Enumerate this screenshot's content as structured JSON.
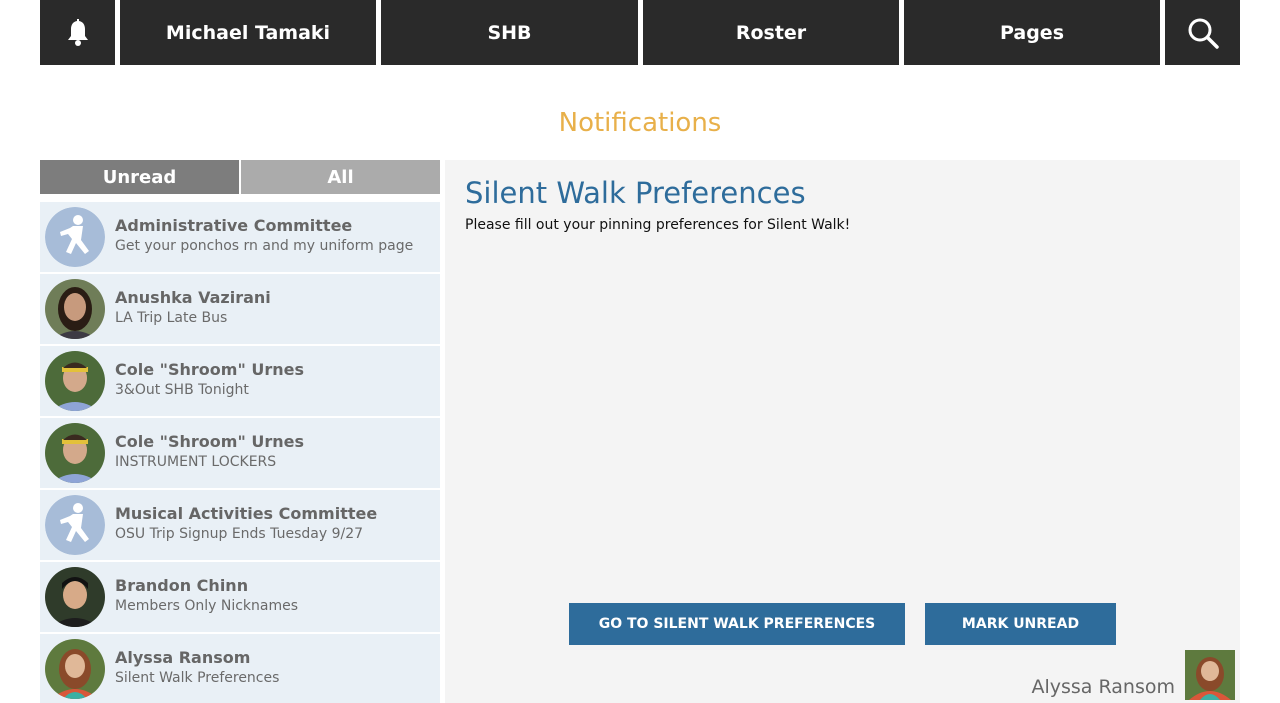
{
  "nav": {
    "bell_icon": "bell-icon",
    "user_name": "Michael Tamaki",
    "shb": "SHB",
    "roster": "Roster",
    "pages": "Pages",
    "search_icon": "search-icon"
  },
  "page_title": "Notifications",
  "tabs": {
    "unread": "Unread",
    "all": "All"
  },
  "notifications": [
    {
      "sender": "Administrative Committee",
      "subject": "Get your ponchos rn and my uniform page",
      "avatar": "climber-logo"
    },
    {
      "sender": "Anushka Vazirani",
      "subject": "LA Trip Late Bus",
      "avatar": "photo"
    },
    {
      "sender": "Cole \"Shroom\" Urnes",
      "subject": "3&Out SHB Tonight",
      "avatar": "photo"
    },
    {
      "sender": "Cole \"Shroom\" Urnes",
      "subject": "INSTRUMENT LOCKERS",
      "avatar": "photo"
    },
    {
      "sender": "Musical Activities Committee",
      "subject": "OSU Trip Signup Ends Tuesday 9/27",
      "avatar": "climber-logo"
    },
    {
      "sender": "Brandon Chinn",
      "subject": "Members Only Nicknames",
      "avatar": "photo"
    },
    {
      "sender": "Alyssa Ransom",
      "subject": "Silent Walk Preferences",
      "avatar": "photo"
    }
  ],
  "detail": {
    "title": "Silent Walk Preferences",
    "body": "Please fill out your pinning preferences for Silent Walk!",
    "primary_button": "GO TO SILENT WALK PREFERENCES",
    "secondary_button": "MARK UNREAD",
    "sender_name": "Alyssa Ransom"
  },
  "colors": {
    "nav_bg": "#2a2a2a",
    "title_accent": "#e8b04a",
    "link_blue": "#2e6c9b",
    "list_bg": "#e9f0f6",
    "tab_active": "#7d7d7d",
    "tab_inactive": "#ababab"
  }
}
